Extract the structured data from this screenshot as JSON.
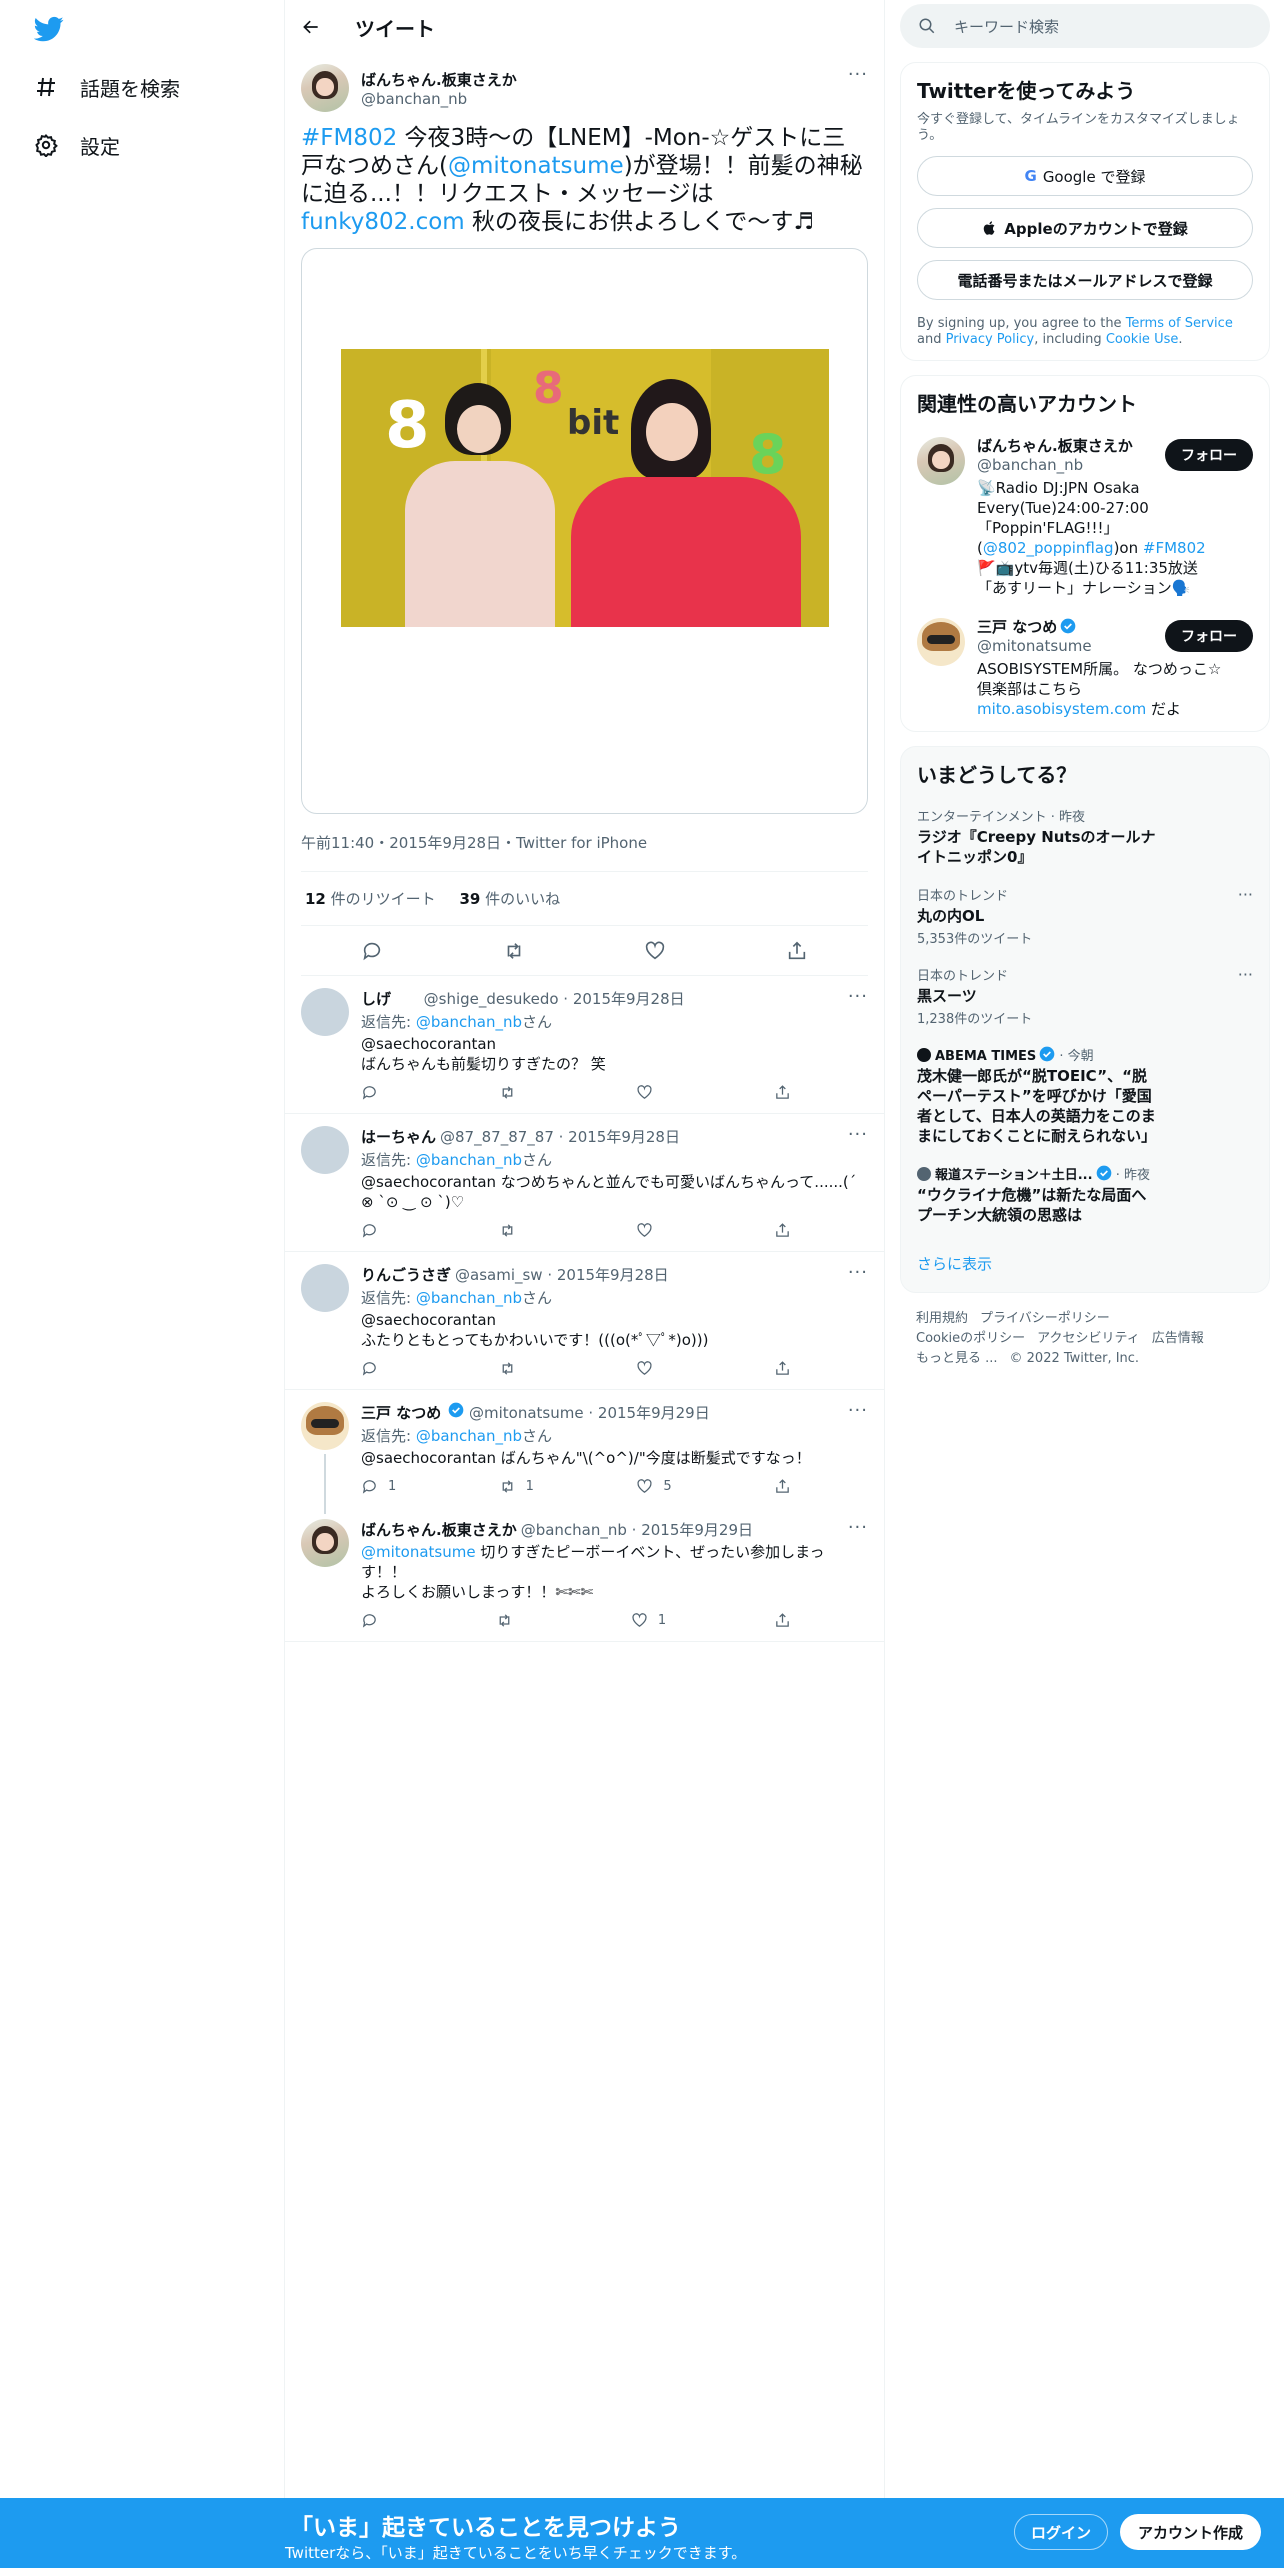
{
  "nav": {
    "explore_label": "話題を検索",
    "settings_label": "設定"
  },
  "header": {
    "title": "ツイート"
  },
  "tweet": {
    "author_name": "ばんちゃん.板東さえか",
    "author_handle": "@banchan_nb",
    "text_hashtag": "#FM802",
    "text_part1": " 今夜3時〜の【LNEM】-Mon-☆ゲストに三戸なつめさん(",
    "text_mention": "@mitonatsume",
    "text_part2": ")が登場！！前髪の神秘に迫る...！！リクエスト・メッセージは",
    "text_link": "funky802.com",
    "text_part3": " 秋の夜長にお供よろしくで〜す♬",
    "photo_text": "bit",
    "photo_eight": "8",
    "time": "午前11:40・2015年9月28日・Twitter for iPhone",
    "retweets": "12",
    "retweets_label": " 件のリツイート",
    "likes": "39",
    "likes_label": " 件のいいね"
  },
  "replies": [
    {
      "name": "しげ",
      "handle": "@shige_desukedo · 2015年9月28日",
      "reply_to_prefix": "返信先: ",
      "reply_to": "@banchan_nb",
      "reply_to_suffix": "さん",
      "line1": "@saechocorantan",
      "line2": "ばんちゃんも前髪切りすぎたの？ 笑",
      "rc": "",
      "rt": "",
      "lk": ""
    },
    {
      "name": "はーちゃん",
      "handle": "@87_87_87_87 · 2015年9月28日",
      "reply_to_prefix": "返信先: ",
      "reply_to": "@banchan_nb",
      "reply_to_suffix": "さん",
      "line1": "@saechocorantan なつめちゃんと並んでも可愛いばんちゃんって......(ˊ ⊗ ˋ⊙ ‿ ⊙ ˋ)♡",
      "line2": "",
      "rc": "",
      "rt": "",
      "lk": ""
    },
    {
      "name": "りんごうさぎ",
      "handle": "@asami_sw · 2015年9月28日",
      "reply_to_prefix": "返信先: ",
      "reply_to": "@banchan_nb",
      "reply_to_suffix": "さん",
      "line1": "@saechocorantan",
      "line2": "ふたりともとってもかわいいです！(((o(*ﾟ▽ﾟ*)o)))",
      "rc": "",
      "rt": "",
      "lk": ""
    },
    {
      "name": "三戸 なつめ",
      "handle": "@mitonatsume · 2015年9月29日",
      "reply_to_prefix": "返信先: ",
      "reply_to": "@banchan_nb",
      "reply_to_suffix": "さん",
      "line1": "@saechocorantan ばんちゃん\"\\(^o^)/\"今度は断髪式ですなっ！",
      "line2": "",
      "rc": "1",
      "rt": "1",
      "lk": "5"
    },
    {
      "name": "ばんちゃん.板東さえか",
      "handle": "@banchan_nb · 2015年9月29日",
      "mention": "@mitonatsume",
      "line1": " 切りすぎたピーボーイベント、ぜったい参加しまっす！！",
      "line2": "よろしくお願いしまっす！！✄✄✄",
      "rc": "",
      "rt": "",
      "lk": "1"
    }
  ],
  "search": {
    "placeholder": "キーワード検索"
  },
  "signup": {
    "title": "Twitterを使ってみよう",
    "subtitle": "今すぐ登録して、タイムラインをカスタマイズしましょう。",
    "google": "Google で登録",
    "apple": "Appleのアカウントで登録",
    "phone": "電話番号またはメールアドレスで登録",
    "terms_prefix": "By signing up, you agree to the ",
    "terms": "Terms of Service",
    "and": " and ",
    "privacy": "Privacy Policy",
    "including": ", including ",
    "cookie": "Cookie Use",
    "period": "."
  },
  "related": {
    "title": "関連性の高いアカウント",
    "follow": "フォロー",
    "acct1": {
      "name": "ばんちゃん.板東さえか",
      "handle": "@banchan_nb",
      "desc1": "📡Radio DJ:JPN Osaka Every(Tue)24:00-27:00 「Poppin'FLAG!!!」(",
      "desc_mention": "@802_poppinflag",
      "desc2": ")on ",
      "desc_tag": "#FM802",
      "desc3": " 🚩📺ytv毎週(土)ひる11:35放送「あすリート」ナレーション🗣️"
    },
    "acct2": {
      "name": "三戸 なつめ",
      "handle": "@mitonatsume",
      "desc1": "ASOBISYSTEM所属。 なつめっこ☆倶楽部はこちら",
      "desc_link": "mito.asobisystem.com",
      "desc2": " だよ"
    }
  },
  "trends": {
    "title": "いまどうしてる？",
    "items": [
      {
        "cat": "エンターテインメント · 昨夜",
        "title": "ラジオ『Creepy Nutsのオールナイトニッポン0』",
        "count": ""
      },
      {
        "cat": "日本のトレンド",
        "title": "丸の内OL",
        "count": "5,353件のツイート"
      },
      {
        "cat": "日本のトレンド",
        "title": "黒スーツ",
        "count": "1,238件のツイート"
      },
      {
        "cat_src": "ABEMA TIMES",
        "cat_time": " · 今朝",
        "title": "茂木健一郎氏が“脱TOEIC”、“脱ペーパーテスト”を呼びかけ「愛国者として、日本人の英語力をこのままにしておくことに耐えられない」",
        "count": ""
      },
      {
        "cat_src": "報道ステーション＋土日...",
        "cat_time": " · 昨夜",
        "title": "“ウクライナ危機”は新たな局面へ プーチン大統領の思惑は",
        "count": ""
      }
    ],
    "show_more": "さらに表示"
  },
  "footer": {
    "l1": "利用規約",
    "l2": "プライバシーポリシー",
    "l3": "Cookieのポリシー",
    "l4": "アクセシビリティ",
    "l5": "広告情報",
    "l6": "もっと見る ...",
    "l7": "© 2022 Twitter, Inc."
  },
  "bottom_bar": {
    "title": "「いま」起きていることを見つけよう",
    "subtitle": "Twitterなら、「いま」起きていることをいち早くチェックできます。",
    "login": "ログイン",
    "signup": "アカウント作成"
  },
  "colors": {
    "accent": "#1d9bf0",
    "text": "#0f1419",
    "secondary": "#536471"
  }
}
